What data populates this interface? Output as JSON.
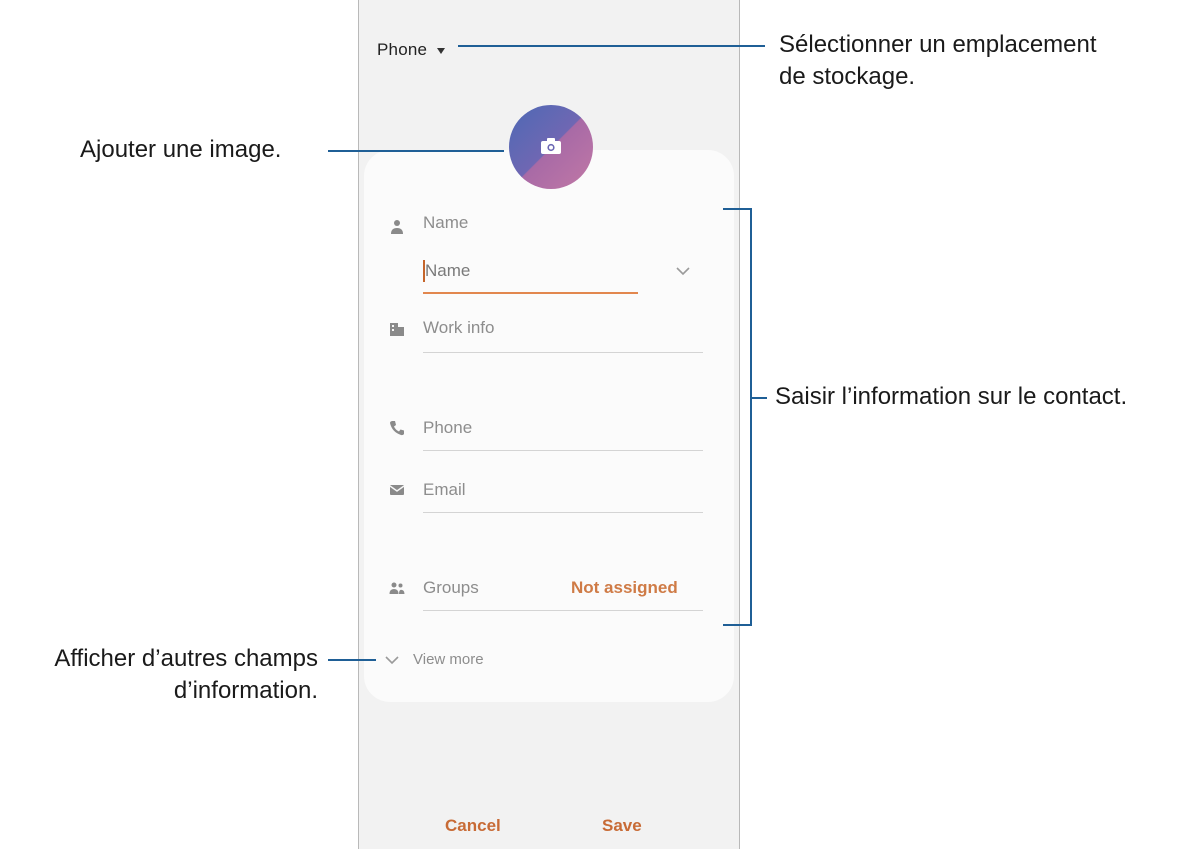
{
  "screen": {
    "storage_label": "Phone",
    "fields": {
      "name_header": "Name",
      "name_input_placeholder": "Name",
      "work_info": "Work info",
      "phone": "Phone",
      "email": "Email",
      "groups": "Groups",
      "groups_value": "Not assigned",
      "view_more": "View more"
    },
    "buttons": {
      "cancel": "Cancel",
      "save": "Save"
    },
    "accent_color": "#c86b36",
    "avatar_colors": [
      "#4d69b4",
      "#c178a5"
    ]
  },
  "annotations": {
    "storage": [
      "Sélectionner un emplacement",
      "de stockage."
    ],
    "add_image": "Ajouter une image.",
    "contact_info": "Saisir l’information sur le contact.",
    "more_fields": [
      "Afficher d’autres champs",
      "d’information."
    ]
  }
}
